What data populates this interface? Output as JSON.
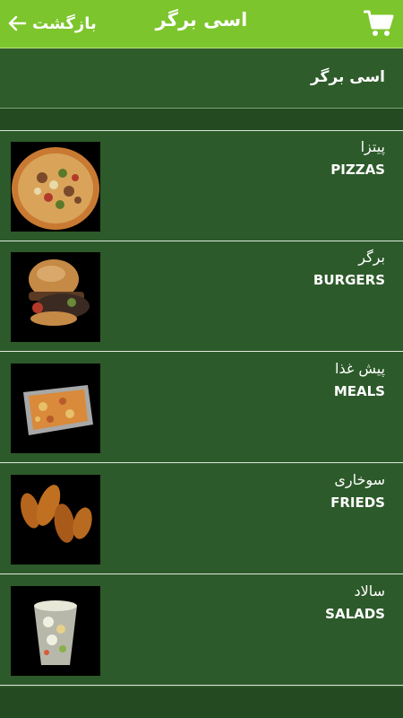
{
  "header": {
    "back_label": "بازگشت",
    "title": "اسی برگر",
    "cart_icon": "cart-icon"
  },
  "restaurant": {
    "name": "اسی برگر"
  },
  "categories": [
    {
      "fa": "پیتزا",
      "en": "PIZZAS",
      "icon": "pizza-image"
    },
    {
      "fa": "برگر",
      "en": "BURGERS",
      "icon": "burger-image"
    },
    {
      "fa": "پیش غذا",
      "en": "MEALS",
      "icon": "meal-image"
    },
    {
      "fa": "سوخاری",
      "en": "FRIEDS",
      "icon": "fried-image"
    },
    {
      "fa": "سالاد",
      "en": "SALADS",
      "icon": "salad-image"
    }
  ],
  "colors": {
    "topbar": "#7cc52c",
    "background": "#2d5a2a",
    "text": "#ffffff"
  }
}
